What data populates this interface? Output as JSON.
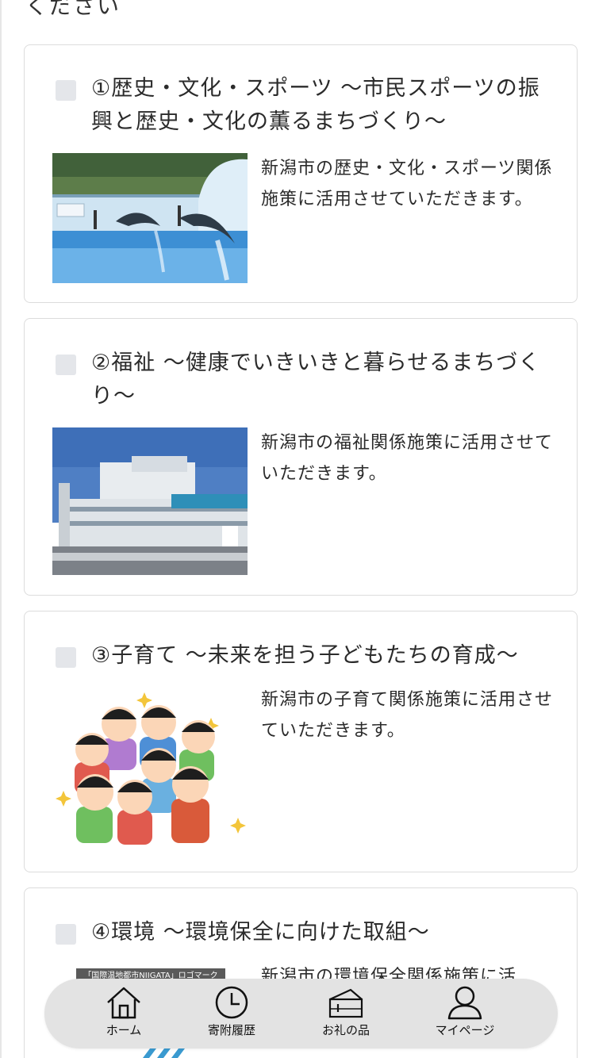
{
  "header": {
    "partial_text": "ください"
  },
  "projects": [
    {
      "title": "①歴史・文化・スポーツ ～市民スポーツの振興と歴史・文化の薫るまちづくり～",
      "image": "dolphin-show-photo",
      "description": "新潟市の歴史・文化・スポーツ関係施策に活用させていただきます。"
    },
    {
      "title": "②福祉 ～健康でいきいきと暮らせるまちづくり～",
      "image": "welfare-building-photo",
      "description": "新潟市の福祉関係施策に活用させていただきます。"
    },
    {
      "title": "③子育て ～未来を担う子どもたちの育成～",
      "image": "children-illustration",
      "description": "新潟市の子育て関係施策に活用させていただきます。"
    },
    {
      "title": "④環境 ～環境保全に向けた取組～",
      "image": "logo-mark-image",
      "image_caption": "「国際温地都市NIIGATA」ロゴマーク",
      "description": "新潟市の環境保全関係施策に活"
    }
  ],
  "bottom_nav": {
    "items": [
      {
        "label": "ホーム",
        "icon": "home-icon"
      },
      {
        "label": "寄附履歴",
        "icon": "clock-icon"
      },
      {
        "label": "お礼の品",
        "icon": "gift-icon"
      },
      {
        "label": "マイページ",
        "icon": "person-icon"
      }
    ]
  },
  "colors": {
    "checkbox": "#e4e6ea",
    "nav_bg": "#e3e3e3",
    "card_border": "#dcdcdc"
  }
}
